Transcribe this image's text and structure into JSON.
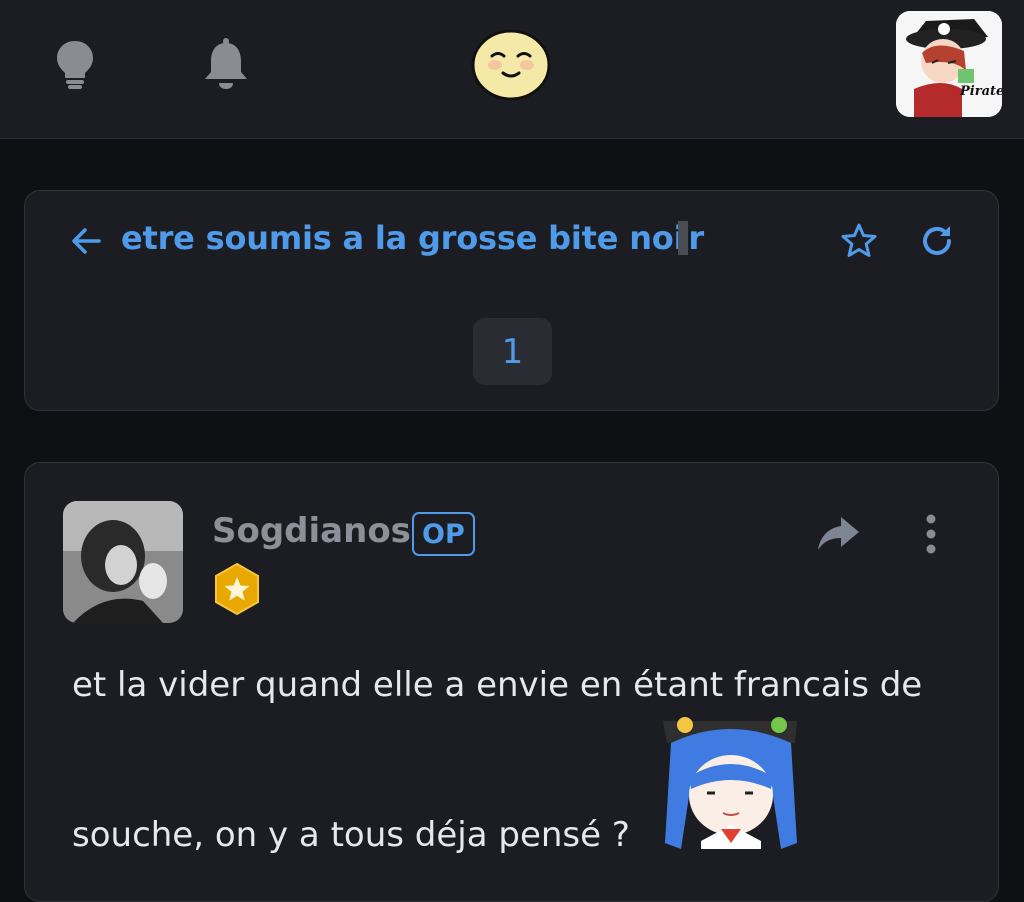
{
  "topbar": {
    "icons": [
      "lightbulb-icon",
      "bell-icon",
      "smiley-emoji-icon"
    ],
    "user_avatar": "pirate-avatar-image",
    "user_avatar_text": "Pirate Du Gange"
  },
  "topic": {
    "title": "etre soumis a la grosse bite noi",
    "title_last_char": "r",
    "back_icon": "arrow-left-icon",
    "favorite_icon": "star-icon",
    "refresh_icon": "refresh-icon",
    "current_page": "1"
  },
  "post": {
    "author": "Sogdianos",
    "op_label": "OP",
    "rank_icon": "gold-star-badge-icon",
    "share_icon": "share-arrow-icon",
    "more_icon": "more-vertical-icon",
    "text_line1": "et la vider quand elle a envie en étant francais de",
    "text_line2": "souche, on y a tous déja pensé ?",
    "sticker": "anime-girl-sticker"
  },
  "colors": {
    "background": "#0f1013",
    "card": "#1c1d22",
    "accent": "#4f9bea",
    "muted": "#8d9099",
    "text": "#e6e8ee"
  }
}
